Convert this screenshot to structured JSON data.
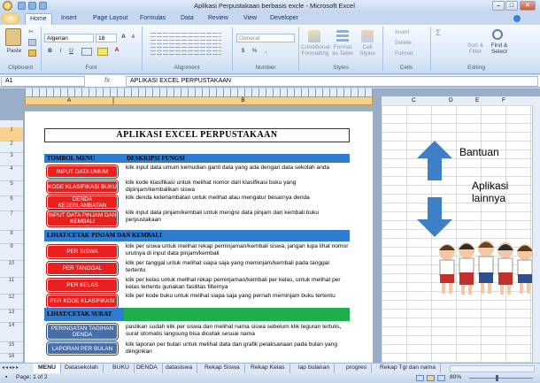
{
  "window": {
    "title": "Aplikasi Perpustakaan berbasis excle  -  Microsoft Excel"
  },
  "tabs": [
    "Home",
    "Insert",
    "Page Layout",
    "Formulas",
    "Data",
    "Review",
    "View",
    "Developer"
  ],
  "ribbon": {
    "clipboard": {
      "paste": "Paste",
      "label": "Clipboard"
    },
    "font": {
      "name": "Algerian",
      "size": "18",
      "bold": "B",
      "italic": "I",
      "underline": "U",
      "grow": "A",
      "shrink": "A",
      "color_a": "A",
      "label": "Font"
    },
    "alignment": {
      "label": "Alignment"
    },
    "number": {
      "format": "General",
      "currency": "$",
      "percent": "%",
      "comma": ",",
      "label": "Number"
    },
    "styles": {
      "conditional": "Conditional\nFormatting",
      "format_table": "Format\nas Table",
      "cell_styles": "Cell\nStyles",
      "label": "Styles"
    },
    "cells": {
      "insert": "Insert",
      "delete": "Delete",
      "format": "Format",
      "label": "Cells"
    },
    "editing": {
      "sum": "Σ",
      "sort": "Sort &\nFilter",
      "find": "Find &\nSelect",
      "label": "Editing"
    }
  },
  "formula_bar": {
    "name_box": "A1",
    "fx": "fx",
    "content": "APLIKASI EXCEL PERPUSTAKAAN"
  },
  "columns": {
    "main": [
      "A",
      "B"
    ],
    "right": [
      "C",
      "D",
      "E",
      "F"
    ]
  },
  "rows": [
    "1",
    "2",
    "3",
    "4",
    "5",
    "6",
    "7",
    "8",
    "9",
    "10",
    "11",
    "12",
    "13",
    "14",
    "15",
    "16"
  ],
  "sheet": {
    "title": "APLIKASI EXCEL PERPUSTAKAAN",
    "header_left": "TOMBOL MENU",
    "header_right": "DESKRIPSI FUNGSI",
    "section1": [
      {
        "button": "INPUT  DATA UMUM",
        "desc": "klik input data umum kemudian ganti data yang ada dengan data sekolah anda"
      },
      {
        "button": "KODE KLASIFIKASI BUKU",
        "desc": "klik kode klasifikasi untuk melihat nomor dari klasifikasi buku yang dipinjam/kembalikan siswa"
      },
      {
        "button": "DENDA KETERLAMBATAN",
        "desc": "klik denda keterlambatan untuk melihat atau mengatur besarnya denda"
      },
      {
        "button": "INPUT DATA PINJAM DAN KEMBALI",
        "desc": "klik input data pinjam/kembali untuk mengisi data pinjam dan kembali buku perpustakaan"
      }
    ],
    "section2_title": "LIHAT/CETAK PINJAM DAN KEMBALI",
    "section2": [
      {
        "button": "PER SISWA",
        "desc": "klik per siswa untuk melihat rekap peminjaman/kembali siswa, jangan lupa lihat nomor urutnya di input data pinjam/kembali"
      },
      {
        "button": "PER TANGGAL",
        "desc": "klik per tanggal untuk melihat siapa saja yang meminjam/kembali pada tanggal tertentu"
      },
      {
        "button": "PER KELAS",
        "desc": "klik per kelas untuk melihat rekap peminjaman/kembali per kelas, untuk melihat per kelas tertentu gunakan fasilitas filternya"
      },
      {
        "button": "PER  KODE KLASIFIKASI",
        "desc": "klik per kode buku untuk melihat siapa saja yang pernah meminjam buku tertentu"
      }
    ],
    "section3_title": "LIHAT/CETAK SURAT",
    "section3": [
      {
        "button": "PERINGATAN TAGIHAN DENDA",
        "desc": "pastikan sudah klik per siswa dan melihat nama siswa sebelum klik teguran tertulis, surat otomatis langsung bisa dicetak sesuai nama"
      },
      {
        "button": "LAPORAN  PER BULAN",
        "desc": "klik laporan per bulan untuk melihat data dan grafik pelaksanaan pada bulan yang diinginkan"
      }
    ]
  },
  "side_panel": {
    "bantuan": "Bantuan",
    "aplikasi": "Aplikasi\nlainnya"
  },
  "sheet_tabs": [
    "MENU",
    "Datasekolah",
    "BUKU",
    "DENDA",
    "datasiswa",
    "Rekap Siswa",
    "Rekap Kelas",
    "lap bulanan",
    "progres",
    "Rekap Tgl dan nama"
  ],
  "status": {
    "page": "Page: 1 of 2",
    "zoom": "80%"
  },
  "colors": {
    "red_button": "#e8201f",
    "blue_button": "#4a6fa7",
    "band_blue": "#2e7bcf",
    "band_green": "#1fae4c",
    "arrow_blue": "#3f7fc6"
  }
}
